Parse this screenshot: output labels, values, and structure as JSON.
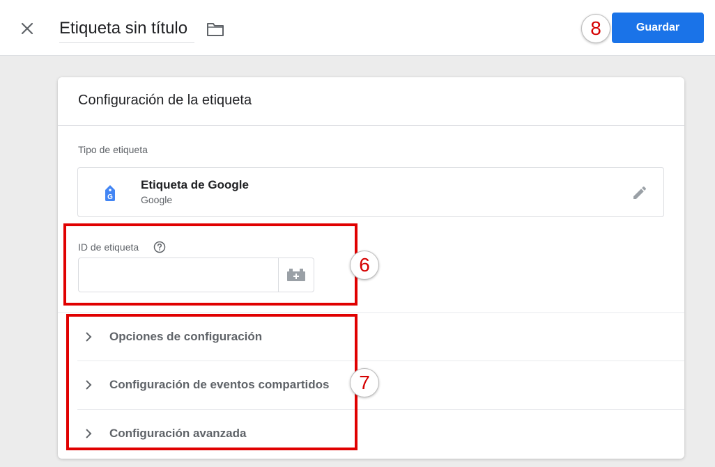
{
  "header": {
    "close_icon": "close-icon",
    "title": "Etiqueta sin título",
    "folder_icon": "folder-icon",
    "save_label": "Guardar",
    "save_color": "#1a73e8"
  },
  "card": {
    "title": "Configuración de la etiqueta",
    "tag_type": {
      "label": "Tipo de etiqueta",
      "name": "Etiqueta de Google",
      "vendor": "Google",
      "icon": "google-tag-icon",
      "icon_color": "#4285f4",
      "edit_icon": "pencil-icon"
    },
    "tag_id": {
      "label": "ID de etiqueta",
      "help_icon": "help-icon",
      "value": "",
      "variable_icon": "variable-picker-icon"
    },
    "sections": [
      {
        "label": "Opciones de configuración"
      },
      {
        "label": "Configuración de eventos compartidos"
      },
      {
        "label": "Configuración avanzada"
      }
    ]
  },
  "annotations": {
    "badge_6": "6",
    "badge_7": "7",
    "badge_8": "8",
    "highlight_color": "#e00000"
  }
}
